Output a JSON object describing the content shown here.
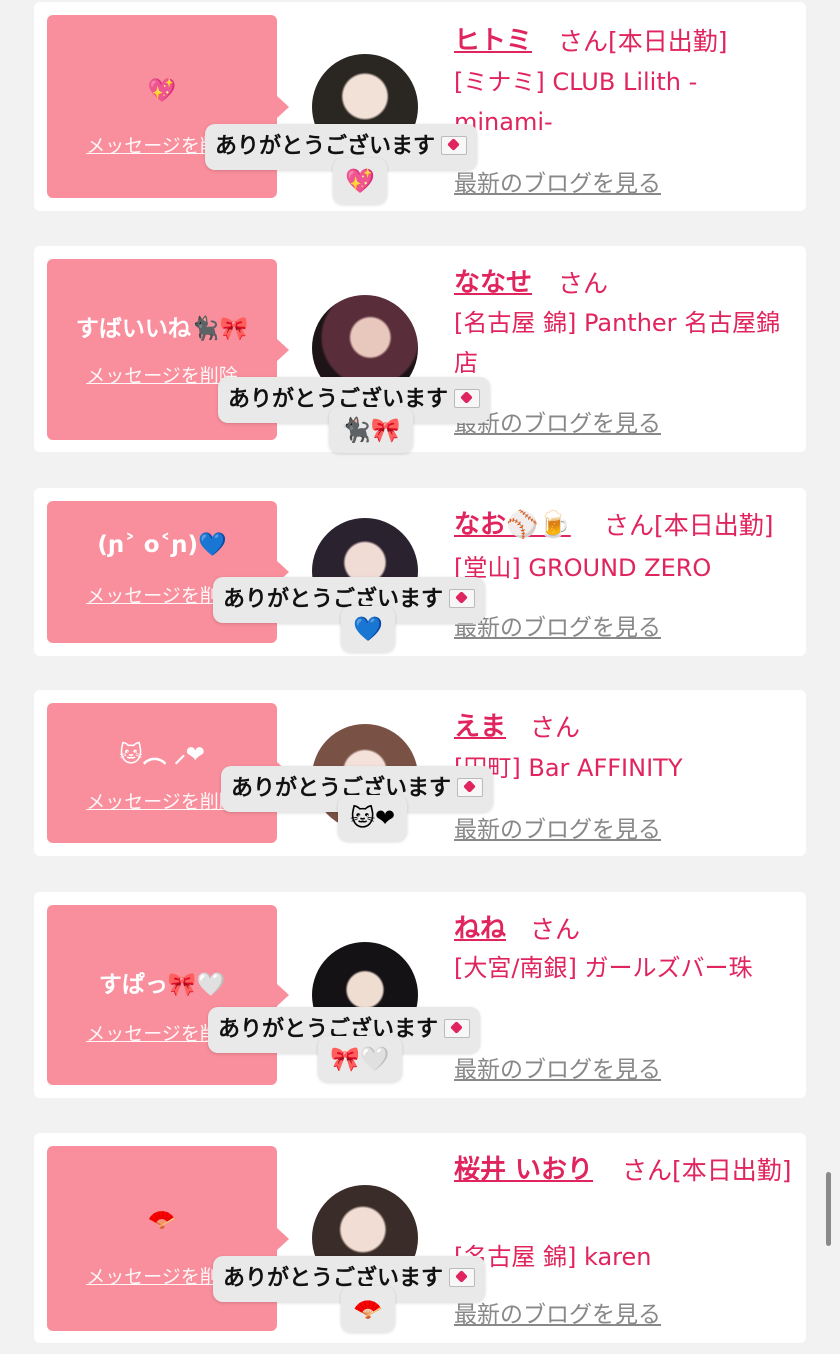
{
  "cards": [
    {
      "msg": "💖",
      "delete_label": "メッセージを削除",
      "name": "ヒトミ",
      "suffix": "さん[本日出勤]",
      "store": "[ミナミ] CLUB Lilith -minami-",
      "blog": "最新のブログを見る",
      "overlay_text": "ありがとうございます",
      "overlay_emoji": "💖"
    },
    {
      "msg": "すばいいね🐈‍⬛🎀",
      "delete_label": "メッセージを削除",
      "name": "ななせ",
      "suffix": "さん",
      "store": "[名古屋 錦] Panther 名古屋錦店",
      "blog": "最新のブログを見る",
      "overlay_text": "ありがとうございます",
      "overlay_emoji": "🐈‍⬛🎀"
    },
    {
      "msg": "(ɲ˃ o˂ɲ)💙",
      "delete_label": "メッセージを削除",
      "name": "なお⚾🍺",
      "suffix": "さん[本日出勤]",
      "store": "[堂山] GROUND ZERO",
      "blog": "最新のブログを見る",
      "overlay_text": "ありがとうございます",
      "overlay_emoji": "💙"
    },
    {
      "msg": "🐱︵ ⸝❤",
      "delete_label": "メッセージを削除",
      "name": "えま",
      "suffix": "さん",
      "store": "[田町] Bar AFFINITY",
      "blog": "最新のブログを見る",
      "overlay_text": "ありがとうございます",
      "overlay_emoji": "🐱❤"
    },
    {
      "msg": "すぱっ🎀🤍",
      "delete_label": "メッセージを削除",
      "name": "ねね",
      "suffix": "さん",
      "store": "[大宮/南銀] ガールズバー珠",
      "blog": "最新のブログを見る",
      "overlay_text": "ありがとうございます",
      "overlay_emoji": "🎀🤍"
    },
    {
      "msg": "🪭",
      "delete_label": "メッセージを削除",
      "name": "桜井 いおり",
      "suffix": "さん[本日出勤]",
      "store": "[名古屋 錦] karen",
      "blog": "最新のブログを見る",
      "overlay_text": "ありがとうございます",
      "overlay_emoji": "🪭"
    }
  ]
}
